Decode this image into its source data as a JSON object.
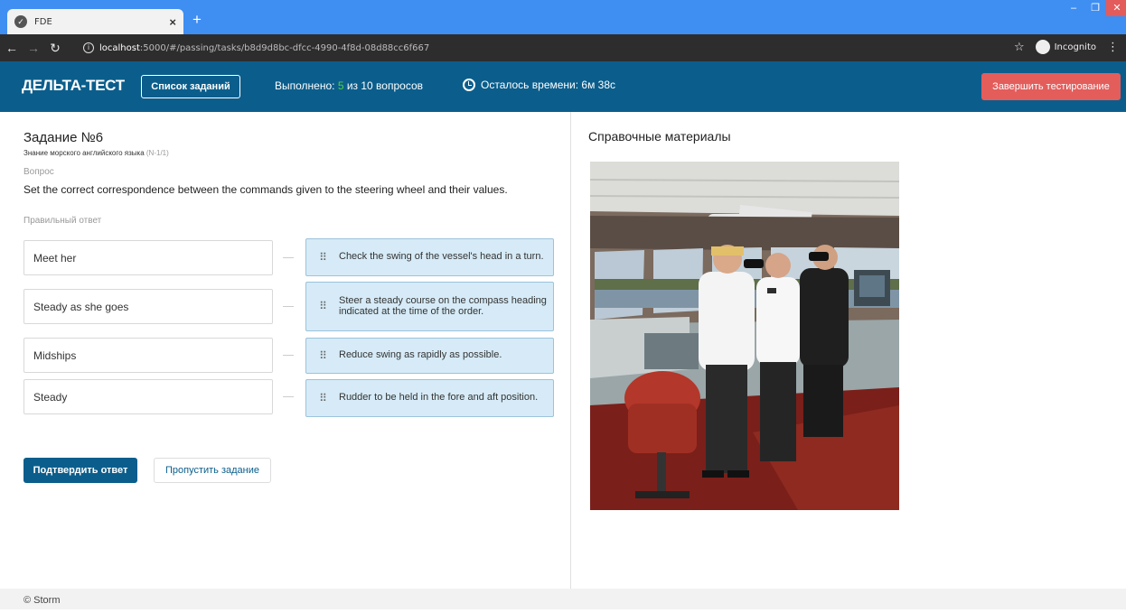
{
  "browser": {
    "tab_title": "FDE",
    "tab_close": "×",
    "new_tab": "+",
    "url_host": "localhost",
    "url_rest": ":5000/#/passing/tasks/b8d9d8bc-dfcc-4990-4f8d-08d88cc6f667",
    "profile_label": "Incognito"
  },
  "header": {
    "brand": "ДЕЛЬТА-ТЕСТ",
    "tasks_button": "Список заданий",
    "progress_prefix": "Выполнено: ",
    "progress_done": "5",
    "progress_suffix": " из 10 вопросов",
    "timer": "Осталось времени: 6м 38с",
    "finish_button": "Завершить тестирование"
  },
  "task": {
    "title": "Задание №6",
    "subtitle": "Знание морского английского языка",
    "code": "(N-1/1)",
    "question_label": "Вопрос",
    "question_text": "Set the correct correspondence between the commands given to the steering wheel and their values.",
    "answer_label": "Правильный ответ",
    "commands": [
      "Meet her",
      "Steady as she goes",
      "Midships",
      "Steady"
    ],
    "definitions": [
      "Check the swing of the vessel's head in a turn.",
      "Steer a steady course on the compass heading indicated at the time of the order.",
      "Reduce swing as rapidly as possible.",
      "Rudder to be held in the fore and aft position."
    ],
    "confirm_button": "Подтвердить ответ",
    "skip_button": "Пропустить задание"
  },
  "reference": {
    "title": "Справочные материалы"
  },
  "footer": {
    "copyright": "© Storm"
  },
  "colors": {
    "header_bg": "#0b5e8c",
    "finish_bg": "#e35d5b",
    "done_count": "#4cd137",
    "definition_bg": "#d6ebf7"
  }
}
